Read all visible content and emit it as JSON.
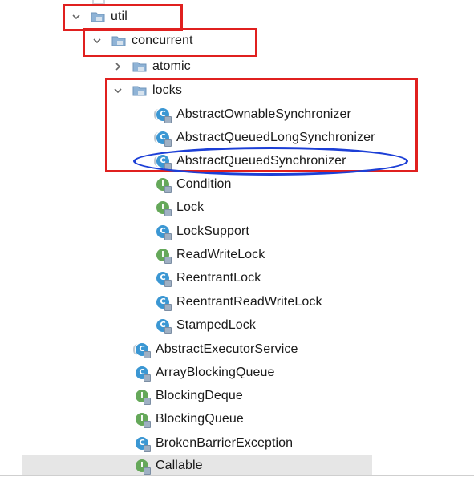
{
  "tree": {
    "util": {
      "label": "util",
      "expanded": true,
      "icon": "folder-icon"
    },
    "concurrent": {
      "label": "concurrent",
      "expanded": true,
      "icon": "folder-icon"
    },
    "atomic": {
      "label": "atomic",
      "expanded": false,
      "icon": "folder-icon"
    },
    "locks": {
      "label": "locks",
      "expanded": true,
      "icon": "folder-icon"
    },
    "locks_children": [
      {
        "label": "AbstractOwnableSynchronizer",
        "kind": "C",
        "abstract": true
      },
      {
        "label": "AbstractQueuedLongSynchronizer",
        "kind": "C",
        "abstract": true
      },
      {
        "label": "AbstractQueuedSynchronizer",
        "kind": "C",
        "abstract": true
      },
      {
        "label": "Condition",
        "kind": "I",
        "abstract": false
      },
      {
        "label": "Lock",
        "kind": "I",
        "abstract": false
      },
      {
        "label": "LockSupport",
        "kind": "C",
        "abstract": false
      },
      {
        "label": "ReadWriteLock",
        "kind": "I",
        "abstract": false
      },
      {
        "label": "ReentrantLock",
        "kind": "C",
        "abstract": false
      },
      {
        "label": "ReentrantReadWriteLock",
        "kind": "C",
        "abstract": false
      },
      {
        "label": "StampedLock",
        "kind": "C",
        "abstract": false
      }
    ],
    "concurrent_children": [
      {
        "label": "AbstractExecutorService",
        "kind": "C",
        "abstract": true
      },
      {
        "label": "ArrayBlockingQueue",
        "kind": "C",
        "abstract": false
      },
      {
        "label": "BlockingDeque",
        "kind": "I",
        "abstract": false
      },
      {
        "label": "BlockingQueue",
        "kind": "I",
        "abstract": false
      },
      {
        "label": "BrokenBarrierException",
        "kind": "C",
        "abstract": false
      },
      {
        "label": "Callable",
        "kind": "I",
        "abstract": false
      }
    ]
  },
  "colors": {
    "highlight_box": "#e0201f",
    "highlight_ellipse": "#1c3fd6",
    "class_icon": "#3b97d3",
    "interface_icon": "#65a85a",
    "selected_row": "#e6e6e6"
  },
  "icon_letters": {
    "class": "C",
    "interface": "I"
  }
}
